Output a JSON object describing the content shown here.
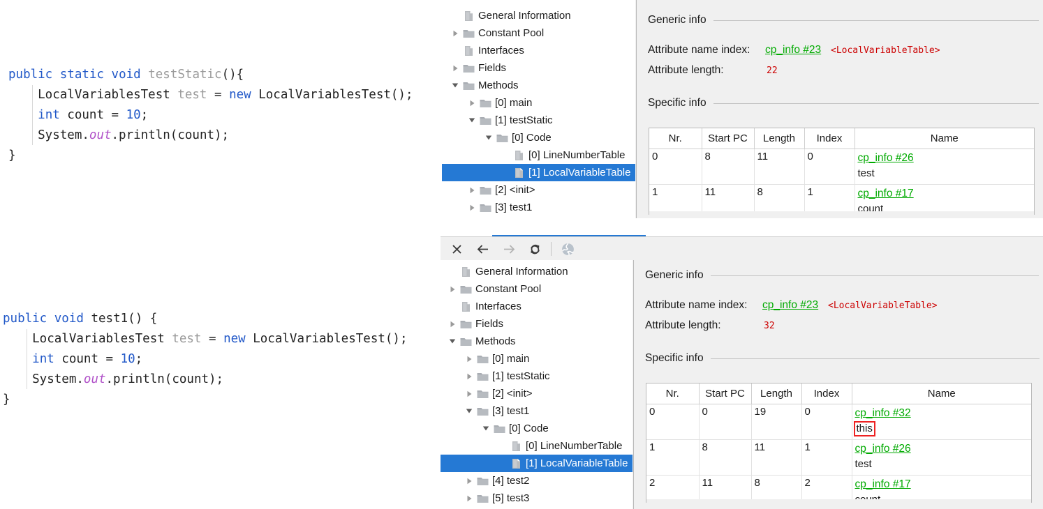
{
  "code_blocks": [
    {
      "name": "testStatic-snippet",
      "lines": [
        [
          {
            "t": "public",
            "c": "kw"
          },
          {
            "t": " ",
            "c": "ident"
          },
          {
            "t": "static",
            "c": "kw"
          },
          {
            "t": " ",
            "c": "ident"
          },
          {
            "t": "void",
            "c": "kw"
          },
          {
            "t": " ",
            "c": "ident"
          },
          {
            "t": "testStatic",
            "c": "method-gray"
          },
          {
            "t": "(){",
            "c": "ident"
          }
        ],
        [
          {
            "t": "    LocalVariablesTest ",
            "c": "ident"
          },
          {
            "t": "test",
            "c": "type-gray"
          },
          {
            "t": " = ",
            "c": "ident"
          },
          {
            "t": "new",
            "c": "kw"
          },
          {
            "t": " LocalVariablesTest();",
            "c": "ident"
          }
        ],
        [
          {
            "t": "    ",
            "c": "ident"
          },
          {
            "t": "int",
            "c": "kw"
          },
          {
            "t": " count = ",
            "c": "ident"
          },
          {
            "t": "10",
            "c": "num"
          },
          {
            "t": ";",
            "c": "ident"
          }
        ],
        [
          {
            "t": "    System.",
            "c": "ident"
          },
          {
            "t": "out",
            "c": "static-it"
          },
          {
            "t": ".println(count);",
            "c": "ident"
          }
        ],
        [
          {
            "t": "}",
            "c": "ident"
          }
        ]
      ]
    },
    {
      "name": "test1-snippet",
      "lines": [
        [
          {
            "t": "public",
            "c": "kw"
          },
          {
            "t": " ",
            "c": "ident"
          },
          {
            "t": "void",
            "c": "kw"
          },
          {
            "t": " ",
            "c": "ident"
          },
          {
            "t": "test1",
            "c": "ident"
          },
          {
            "t": "() {",
            "c": "ident"
          }
        ],
        [
          {
            "t": "    LocalVariablesTest ",
            "c": "ident"
          },
          {
            "t": "test",
            "c": "type-gray"
          },
          {
            "t": " = ",
            "c": "ident"
          },
          {
            "t": "new",
            "c": "kw"
          },
          {
            "t": " LocalVariablesTest();",
            "c": "ident"
          }
        ],
        [
          {
            "t": "    ",
            "c": "ident"
          },
          {
            "t": "int",
            "c": "kw"
          },
          {
            "t": " count = ",
            "c": "ident"
          },
          {
            "t": "10",
            "c": "num"
          },
          {
            "t": ";",
            "c": "ident"
          }
        ],
        [
          {
            "t": "    System.",
            "c": "ident"
          },
          {
            "t": "out",
            "c": "static-it"
          },
          {
            "t": ".println(count);",
            "c": "ident"
          }
        ],
        [
          {
            "t": "}",
            "c": "ident"
          }
        ]
      ]
    }
  ],
  "top_window": {
    "tree": {
      "items": [
        {
          "label": "General Information",
          "depth": 1,
          "icon": "file-icon",
          "twisty": "none",
          "selected": false
        },
        {
          "label": "Constant Pool",
          "depth": 1,
          "icon": "folder-icon",
          "twisty": "collapsed",
          "selected": false
        },
        {
          "label": "Interfaces",
          "depth": 1,
          "icon": "file-icon",
          "twisty": "none",
          "selected": false
        },
        {
          "label": "Fields",
          "depth": 1,
          "icon": "folder-icon",
          "twisty": "collapsed",
          "selected": false
        },
        {
          "label": "Methods",
          "depth": 1,
          "icon": "folder-icon",
          "twisty": "expanded",
          "selected": false
        },
        {
          "label": "[0] main",
          "depth": 2,
          "icon": "folder-icon",
          "twisty": "collapsed",
          "selected": false
        },
        {
          "label": "[1] testStatic",
          "depth": 2,
          "icon": "folder-icon",
          "twisty": "expanded",
          "selected": false
        },
        {
          "label": "[0] Code",
          "depth": 3,
          "icon": "folder-icon",
          "twisty": "expanded",
          "selected": false
        },
        {
          "label": "[0] LineNumberTable",
          "depth": 4,
          "icon": "file-icon",
          "twisty": "none",
          "selected": false
        },
        {
          "label": "[1] LocalVariableTable",
          "depth": 4,
          "icon": "file-icon",
          "twisty": "none",
          "selected": true
        },
        {
          "label": "[2] <init>",
          "depth": 2,
          "icon": "folder-icon",
          "twisty": "collapsed",
          "selected": false
        },
        {
          "label": "[3] test1",
          "depth": 2,
          "icon": "folder-icon",
          "twisty": "collapsed",
          "selected": false
        }
      ]
    },
    "detail": {
      "generic_section": "Generic info",
      "specific_section": "Specific info",
      "attribute_name_index_label": "Attribute name index:",
      "attribute_name_index_link": "cp_info #23",
      "attribute_name_index_value": "<LocalVariableTable>",
      "attribute_length_label": "Attribute length:",
      "attribute_length_value": "22"
    },
    "table": {
      "columns": [
        "Nr.",
        "Start PC",
        "Length",
        "Index",
        "Name"
      ],
      "rows": [
        {
          "nr": "0",
          "start_pc": "8",
          "length": "11",
          "index": "0",
          "name_link": "cp_info #26",
          "name_value": "test",
          "highlight": false
        },
        {
          "nr": "1",
          "start_pc": "11",
          "length": "8",
          "index": "1",
          "name_link": "cp_info #17",
          "name_value": "count",
          "highlight": false
        }
      ]
    }
  },
  "bottom_window": {
    "toolbar": {
      "buttons": [
        {
          "name": "close-icon",
          "title": "Close",
          "enabled": true
        },
        {
          "name": "back-arrow-icon",
          "title": "Back",
          "enabled": true
        },
        {
          "name": "forward-arrow-icon",
          "title": "Forward",
          "enabled": false
        },
        {
          "name": "reload-icon",
          "title": "Reload",
          "enabled": true
        },
        {
          "name": "globe-icon",
          "title": "Browse",
          "enabled": false
        }
      ]
    },
    "tree": {
      "items": [
        {
          "label": "General Information",
          "depth": 1,
          "icon": "file-icon",
          "twisty": "none",
          "selected": false
        },
        {
          "label": "Constant Pool",
          "depth": 1,
          "icon": "folder-icon",
          "twisty": "collapsed",
          "selected": false
        },
        {
          "label": "Interfaces",
          "depth": 1,
          "icon": "file-icon",
          "twisty": "none",
          "selected": false
        },
        {
          "label": "Fields",
          "depth": 1,
          "icon": "folder-icon",
          "twisty": "collapsed",
          "selected": false
        },
        {
          "label": "Methods",
          "depth": 1,
          "icon": "folder-icon",
          "twisty": "expanded",
          "selected": false
        },
        {
          "label": "[0] main",
          "depth": 2,
          "icon": "folder-icon",
          "twisty": "collapsed",
          "selected": false
        },
        {
          "label": "[1] testStatic",
          "depth": 2,
          "icon": "folder-icon",
          "twisty": "collapsed",
          "selected": false
        },
        {
          "label": "[2] <init>",
          "depth": 2,
          "icon": "folder-icon",
          "twisty": "collapsed",
          "selected": false
        },
        {
          "label": "[3] test1",
          "depth": 2,
          "icon": "folder-icon",
          "twisty": "expanded",
          "selected": false
        },
        {
          "label": "[0] Code",
          "depth": 3,
          "icon": "folder-icon",
          "twisty": "expanded",
          "selected": false
        },
        {
          "label": "[0] LineNumberTable",
          "depth": 4,
          "icon": "file-icon",
          "twisty": "none",
          "selected": false
        },
        {
          "label": "[1] LocalVariableTable",
          "depth": 4,
          "icon": "file-icon",
          "twisty": "none",
          "selected": true
        },
        {
          "label": "[4] test2",
          "depth": 2,
          "icon": "folder-icon",
          "twisty": "collapsed",
          "selected": false
        },
        {
          "label": "[5] test3",
          "depth": 2,
          "icon": "folder-icon",
          "twisty": "collapsed",
          "selected": false
        }
      ]
    },
    "detail": {
      "generic_section": "Generic info",
      "specific_section": "Specific info",
      "attribute_name_index_label": "Attribute name index:",
      "attribute_name_index_link": "cp_info #23",
      "attribute_name_index_value": "<LocalVariableTable>",
      "attribute_length_label": "Attribute length:",
      "attribute_length_value": "32"
    },
    "table": {
      "columns": [
        "Nr.",
        "Start PC",
        "Length",
        "Index",
        "Name"
      ],
      "rows": [
        {
          "nr": "0",
          "start_pc": "0",
          "length": "19",
          "index": "0",
          "name_link": "cp_info #32",
          "name_value": "this",
          "highlight": true
        },
        {
          "nr": "1",
          "start_pc": "8",
          "length": "11",
          "index": "1",
          "name_link": "cp_info #26",
          "name_value": "test",
          "highlight": false
        },
        {
          "nr": "2",
          "start_pc": "11",
          "length": "8",
          "index": "2",
          "name_link": "cp_info #17",
          "name_value": "count",
          "highlight": false
        }
      ]
    }
  },
  "colors": {
    "selection_blue": "#2579d4",
    "link_green": "#00aa00",
    "value_red": "#cc0000",
    "highlight_red": "#ee2222",
    "panel_gray": "#f0f0f0",
    "keyword_blue": "#2158c8",
    "static_purple": "#b050c8"
  }
}
